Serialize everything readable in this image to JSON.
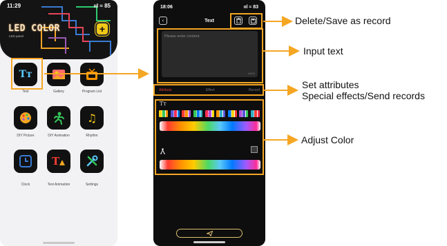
{
  "home": {
    "status_time": "11:29",
    "status_right": "ııl ≈ 85",
    "app_logo": "LED COLOR",
    "app_sub": "LED panel",
    "tiles": [
      {
        "label": "Text",
        "icon": "text-icon"
      },
      {
        "label": "Gallery",
        "icon": "gallery-icon"
      },
      {
        "label": "Program List",
        "icon": "program-list-icon"
      },
      {
        "label": "DIY Picture",
        "icon": "diy-picture-icon"
      },
      {
        "label": "DIY Animation",
        "icon": "diy-animation-icon"
      },
      {
        "label": "Rhythm",
        "icon": "rhythm-icon"
      },
      {
        "label": "Clock",
        "icon": "clock-icon"
      },
      {
        "label": "Text Animation",
        "icon": "text-animation-icon"
      },
      {
        "label": "Settings",
        "icon": "settings-icon"
      }
    ]
  },
  "text_page": {
    "status_time": "18:06",
    "status_right": "ııl ≈ 83",
    "title": "Text",
    "input_placeholder": "Please enter content",
    "input_counter": "0/600",
    "tabs": [
      "Attribute",
      "Effect",
      "Record"
    ],
    "text_color_glyph": "Tт",
    "bg_color_glyph": "⛶",
    "swatch_colors": [
      "#ffd60a",
      "#5856d6",
      "#ff3b30",
      "#34c759",
      "#ff2d55",
      "#ff9500",
      "#007aff",
      "#af52de",
      "#30b0c7"
    ],
    "accent": "#f5a623"
  },
  "annotations": {
    "delete_save": "Delete/Save as record",
    "input_text": "Input text",
    "set_attributes": "Set attributes",
    "special_effects": "Special effects/Send records",
    "adjust_color": "Adjust Color"
  }
}
